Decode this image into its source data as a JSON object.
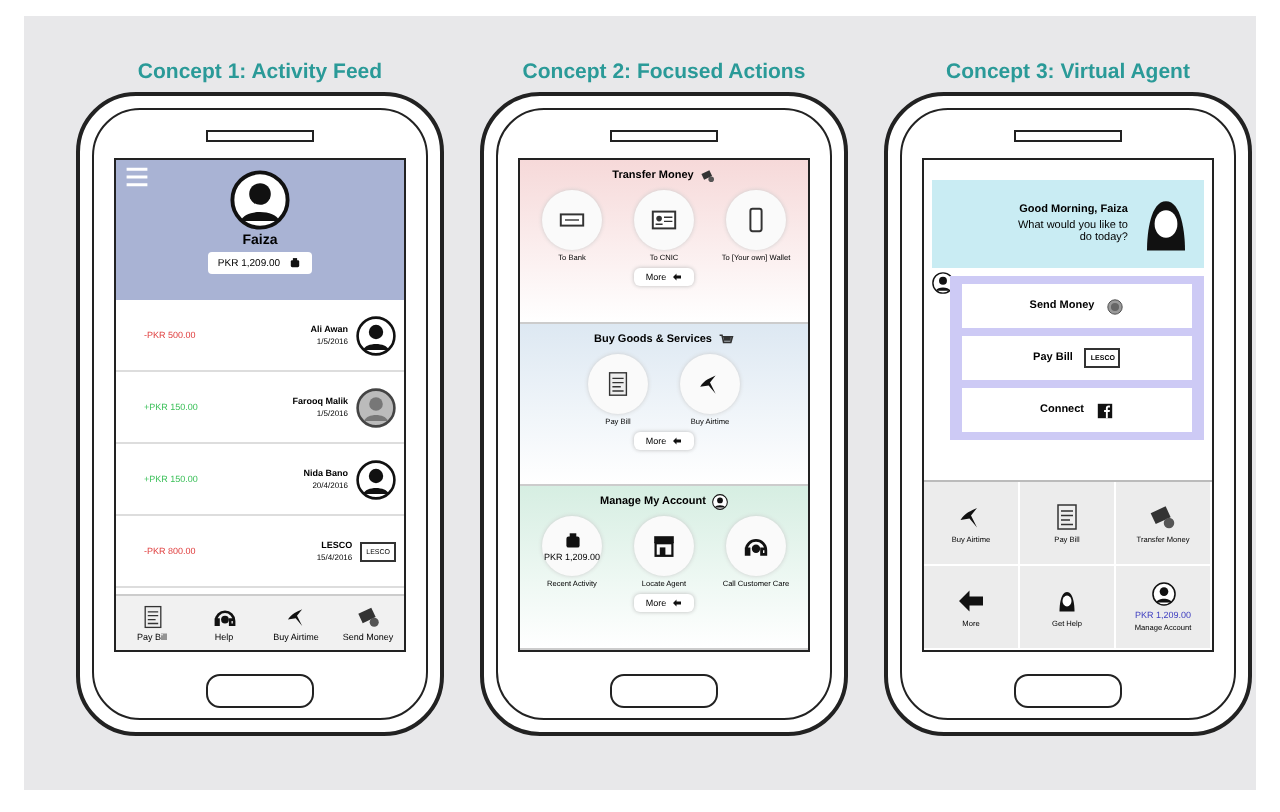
{
  "concepts": [
    {
      "kind": "feed",
      "title": "Concept 1: Activity Feed",
      "user": "Faiza",
      "balance": "PKR 1,209.00",
      "rows": [
        {
          "amount": "-PKR 500.00",
          "kind": "debit",
          "name": "Ali Awan",
          "date": "1/5/2016"
        },
        {
          "amount": "+PKR 150.00",
          "kind": "credit",
          "name": "Farooq Malik",
          "date": "1/5/2016"
        },
        {
          "amount": "+PKR 150.00",
          "kind": "credit",
          "name": "Nida Bano",
          "date": "20/4/2016"
        },
        {
          "amount": "-PKR 800.00",
          "kind": "debit",
          "name": "LESCO",
          "date": "15/4/2016",
          "logo": "LESCO"
        }
      ],
      "nav": [
        {
          "label": "Pay Bill"
        },
        {
          "label": "Help"
        },
        {
          "label": "Buy Airtime"
        },
        {
          "label": "Send Money"
        }
      ]
    },
    {
      "kind": "actions",
      "title": "Concept 2: Focused Actions",
      "sections": [
        {
          "heading": "Transfer Money",
          "items": [
            {
              "label": "To Bank"
            },
            {
              "label": "To CNIC"
            },
            {
              "label": "To [Your own] Wallet"
            }
          ],
          "more": "More"
        },
        {
          "heading": "Buy Goods & Services",
          "items": [
            {
              "label": "Pay Bill"
            },
            {
              "label": "Buy Airtime"
            }
          ],
          "more": "More"
        },
        {
          "heading": "Manage My Account",
          "items": [
            {
              "label": "Recent Activity",
              "caption": "PKR 1,209.00"
            },
            {
              "label": "Locate Agent"
            },
            {
              "label": "Call Customer Care"
            }
          ],
          "more": "More"
        }
      ]
    },
    {
      "kind": "agent",
      "title": "Concept 3: Virtual Agent",
      "greeting": "Good Morning, Faiza",
      "question": "What would you like to do today?",
      "options": [
        {
          "label": "Send Money"
        },
        {
          "label": "Pay Bill",
          "logo": "LESCO"
        },
        {
          "label": "Connect"
        }
      ],
      "grid": [
        {
          "label": "Buy Airtime"
        },
        {
          "label": "Pay Bill"
        },
        {
          "label": "Transfer Money"
        },
        {
          "label": "More"
        },
        {
          "label": "Get Help"
        },
        {
          "label": "Manage Account",
          "caption": "PKR 1,209.00"
        }
      ]
    }
  ]
}
